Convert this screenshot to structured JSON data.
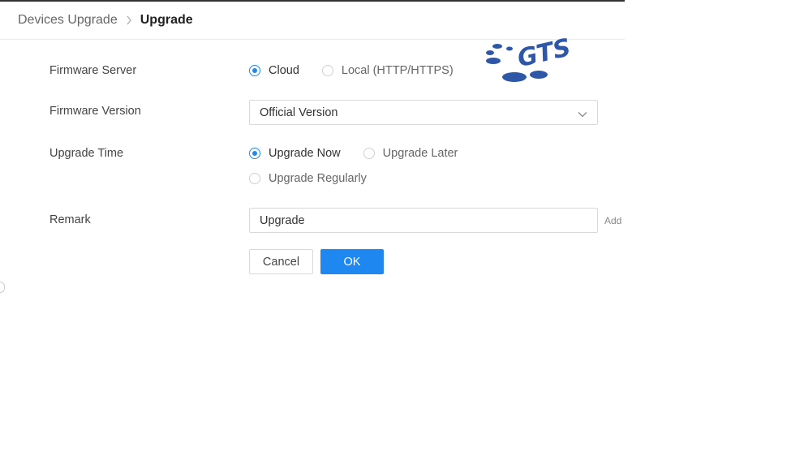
{
  "breadcrumb": {
    "parent": "Devices Upgrade",
    "current": "Upgrade"
  },
  "form": {
    "firmware_server": {
      "label": "Firmware Server",
      "options": [
        {
          "label": "Cloud",
          "checked": true
        },
        {
          "label": "Local (HTTP/HTTPS)",
          "checked": false
        }
      ]
    },
    "firmware_version": {
      "label": "Firmware Version",
      "value": "Official Version"
    },
    "upgrade_time": {
      "label": "Upgrade Time",
      "options": [
        {
          "label": "Upgrade Now",
          "checked": true
        },
        {
          "label": "Upgrade Later",
          "checked": false
        },
        {
          "label": "Upgrade Regularly",
          "checked": false
        }
      ]
    },
    "remark": {
      "label": "Remark",
      "value": "Upgrade",
      "add_label": "Add"
    }
  },
  "buttons": {
    "cancel": "Cancel",
    "ok": "OK"
  },
  "logo": {
    "text": "GTS"
  },
  "colors": {
    "primary": "#1e88f0",
    "logo_blue": "#2f57a8"
  }
}
